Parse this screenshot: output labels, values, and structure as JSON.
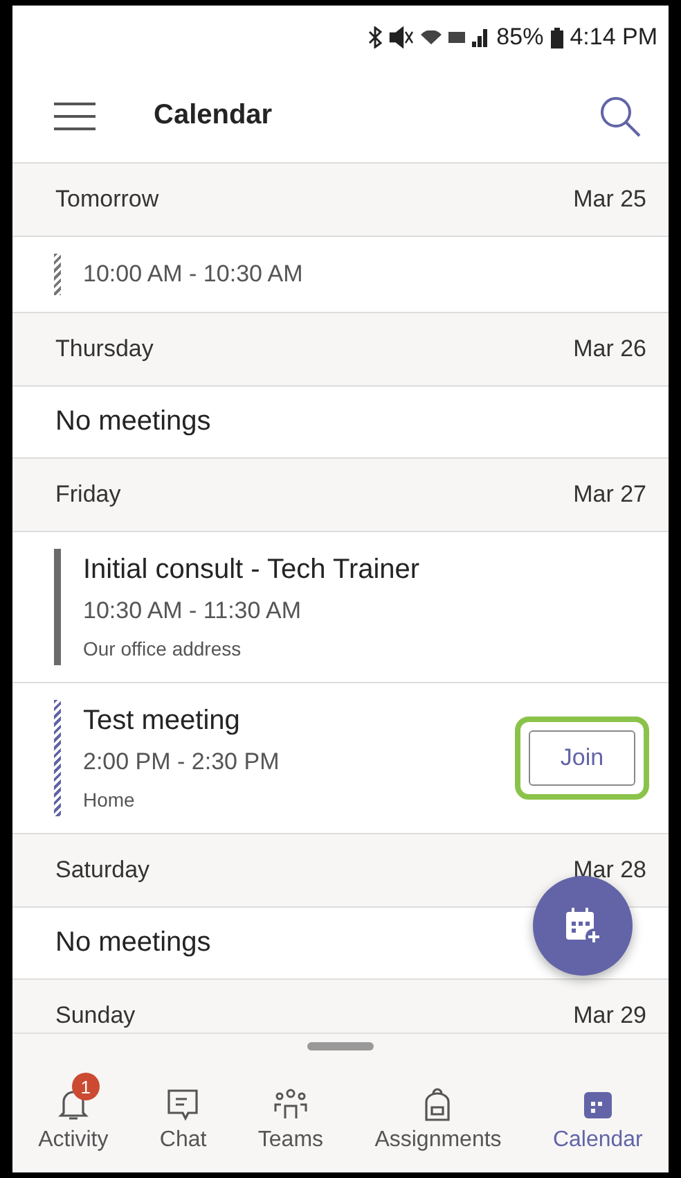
{
  "status_bar": {
    "battery": "85%",
    "time": "4:14 PM"
  },
  "header": {
    "title": "Calendar"
  },
  "agenda": [
    {
      "kind": "day",
      "label": "Tomorrow",
      "date": "Mar 25"
    },
    {
      "kind": "event",
      "time": "10:00 AM - 10:30 AM",
      "hatched": true,
      "color": "#777777"
    },
    {
      "kind": "day",
      "label": "Thursday",
      "date": "Mar 26"
    },
    {
      "kind": "empty",
      "text": "No meetings"
    },
    {
      "kind": "day",
      "label": "Friday",
      "date": "Mar 27"
    },
    {
      "kind": "event",
      "title": "Initial consult - Tech Trainer",
      "time": "10:30 AM - 11:30 AM",
      "location": "Our office address",
      "hatched": false,
      "color": "#6b6b6b"
    },
    {
      "kind": "event",
      "title": "Test meeting",
      "time": "2:00 PM - 2:30 PM",
      "location": "Home",
      "hatched": true,
      "color": "#6264a7",
      "join": {
        "label": "Join",
        "highlighted": true
      }
    },
    {
      "kind": "day",
      "label": "Saturday",
      "date": "Mar 28"
    },
    {
      "kind": "empty",
      "text": "No meetings"
    },
    {
      "kind": "day",
      "label": "Sunday",
      "date": "Mar 29"
    }
  ],
  "nav": [
    {
      "label": "Activity",
      "badge": "1",
      "selected": false
    },
    {
      "label": "Chat",
      "selected": false
    },
    {
      "label": "Teams",
      "selected": false
    },
    {
      "label": "Assignments",
      "selected": false
    },
    {
      "label": "Calendar",
      "selected": true
    }
  ]
}
